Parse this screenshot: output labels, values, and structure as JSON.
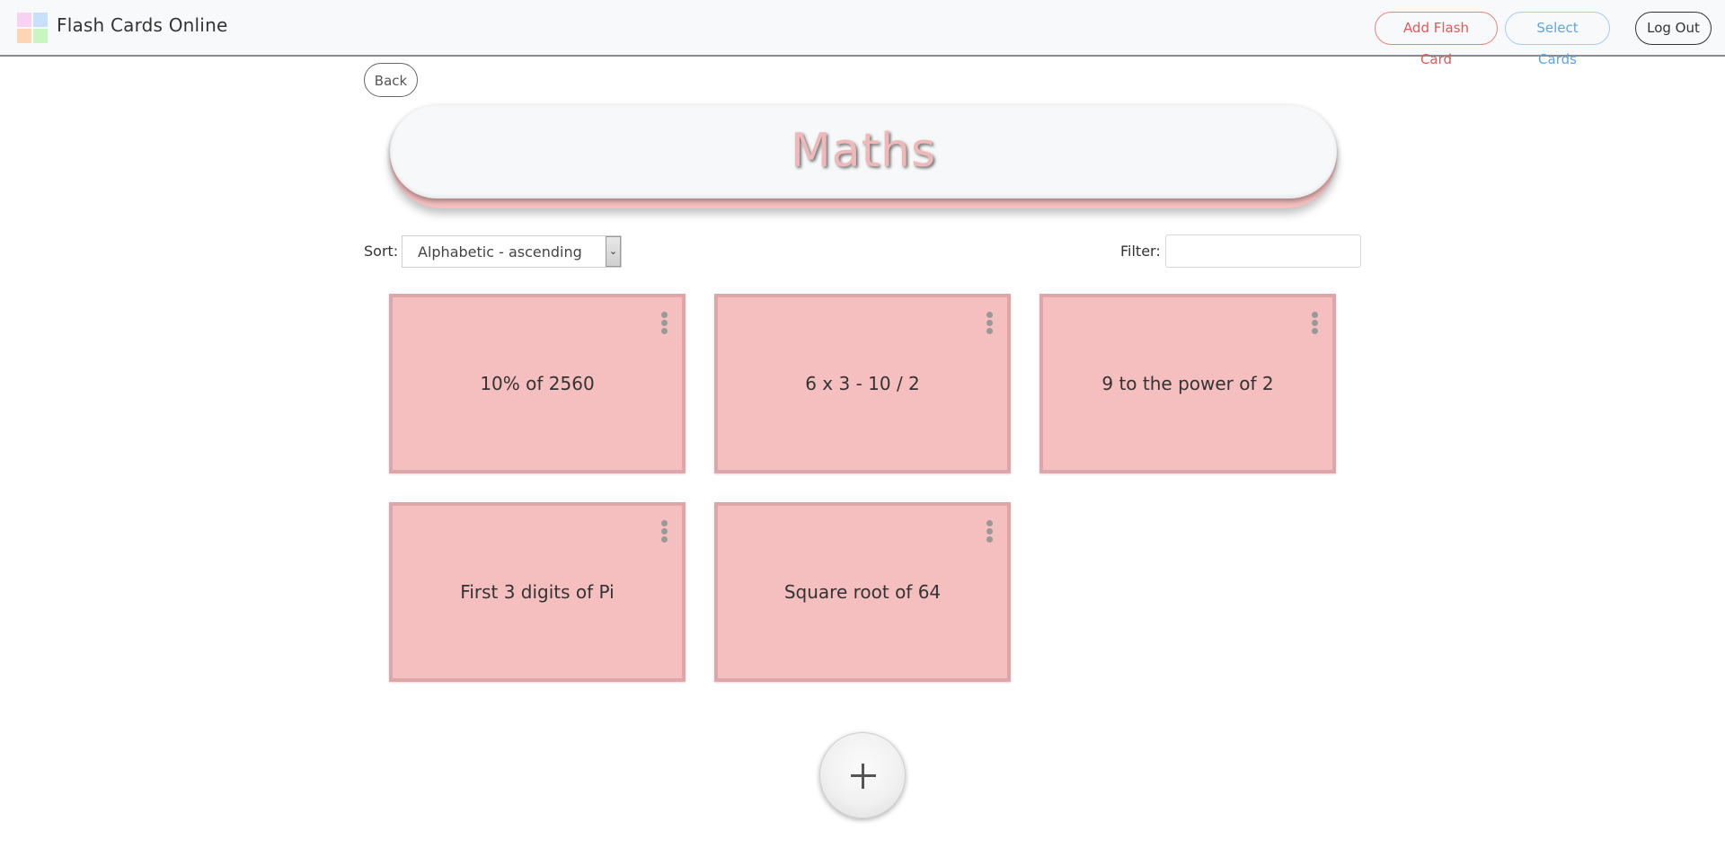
{
  "header": {
    "brand": "Flash Cards Online",
    "add_label": "Add Flash Card",
    "select_label": "Select Cards",
    "logout_label": "Log Out"
  },
  "back_label": "Back",
  "deck_title": "Maths",
  "controls": {
    "sort_label": "Sort:",
    "sort_value": "Alphabetic - ascending",
    "filter_label": "Filter:",
    "filter_value": ""
  },
  "cards": [
    {
      "text": "10% of 2560"
    },
    {
      "text": "6 x 3 - 10 / 2"
    },
    {
      "text": "9 to the power of 2"
    },
    {
      "text": "First 3 digits of Pi"
    },
    {
      "text": "Square root of 64"
    }
  ],
  "colors": {
    "card_fill": "#f5bfbf",
    "card_border": "#dea6a9",
    "add_btn": "#e05a5a",
    "select_btn": "#5ba6e8"
  }
}
